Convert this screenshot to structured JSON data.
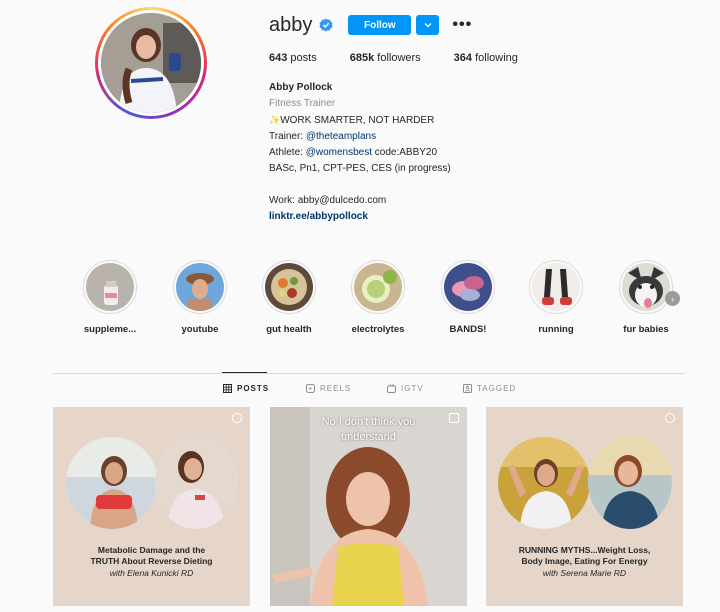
{
  "profile": {
    "username": "abby",
    "follow_label": "Follow",
    "more_label": "•••",
    "stats": [
      {
        "value": "643",
        "label": "posts"
      },
      {
        "value": "685k",
        "label": "followers"
      },
      {
        "value": "364",
        "label": "following"
      }
    ],
    "bio": {
      "name": "Abby Pollock",
      "category": "Fitness Trainer",
      "line1": "WORK SMARTER, NOT HARDER",
      "trainer_prefix": "Trainer: ",
      "trainer_link": "@theteamplans",
      "athlete_prefix": "Athlete: ",
      "athlete_link": "@womensbest",
      "athlete_suffix": " code:ABBY20",
      "credentials": "BASc, Pn1, CPT-PES, CES (in progress)",
      "work": "Work: abby@dulcedo.com",
      "website": "linktr.ee/abbypollock"
    }
  },
  "highlights": [
    {
      "label": "suppleme...",
      "icon": "supplements-thumb"
    },
    {
      "label": "youtube",
      "icon": "youtube-thumb"
    },
    {
      "label": "gut health",
      "icon": "gut-health-thumb"
    },
    {
      "label": "electrolytes",
      "icon": "electrolytes-thumb"
    },
    {
      "label": "BANDS!",
      "icon": "bands-thumb"
    },
    {
      "label": "running",
      "icon": "running-thumb"
    },
    {
      "label": "fur babies",
      "icon": "fur-babies-thumb"
    }
  ],
  "tabs": [
    {
      "label": "POSTS",
      "active": true
    },
    {
      "label": "REELS",
      "active": false
    },
    {
      "label": "IGTV",
      "active": false
    },
    {
      "label": "TAGGED",
      "active": false
    }
  ],
  "posts": [
    {
      "title_line1": "Metabolic Damage and the",
      "title_line2": "TRUTH About Reverse Dieting",
      "subtitle": "with Elena Kunicki RD"
    },
    {
      "caption_line1": "No I don't think you",
      "caption_line2": "understand"
    },
    {
      "title_line1": "RUNNING MYTHS...Weight Loss,",
      "title_line2": "Body Image, Eating For Energy",
      "subtitle": "with Serena Marie RD"
    }
  ],
  "colors": {
    "accent": "#0095f6",
    "link": "#00376b",
    "post_bg": "#e5d6c9"
  }
}
